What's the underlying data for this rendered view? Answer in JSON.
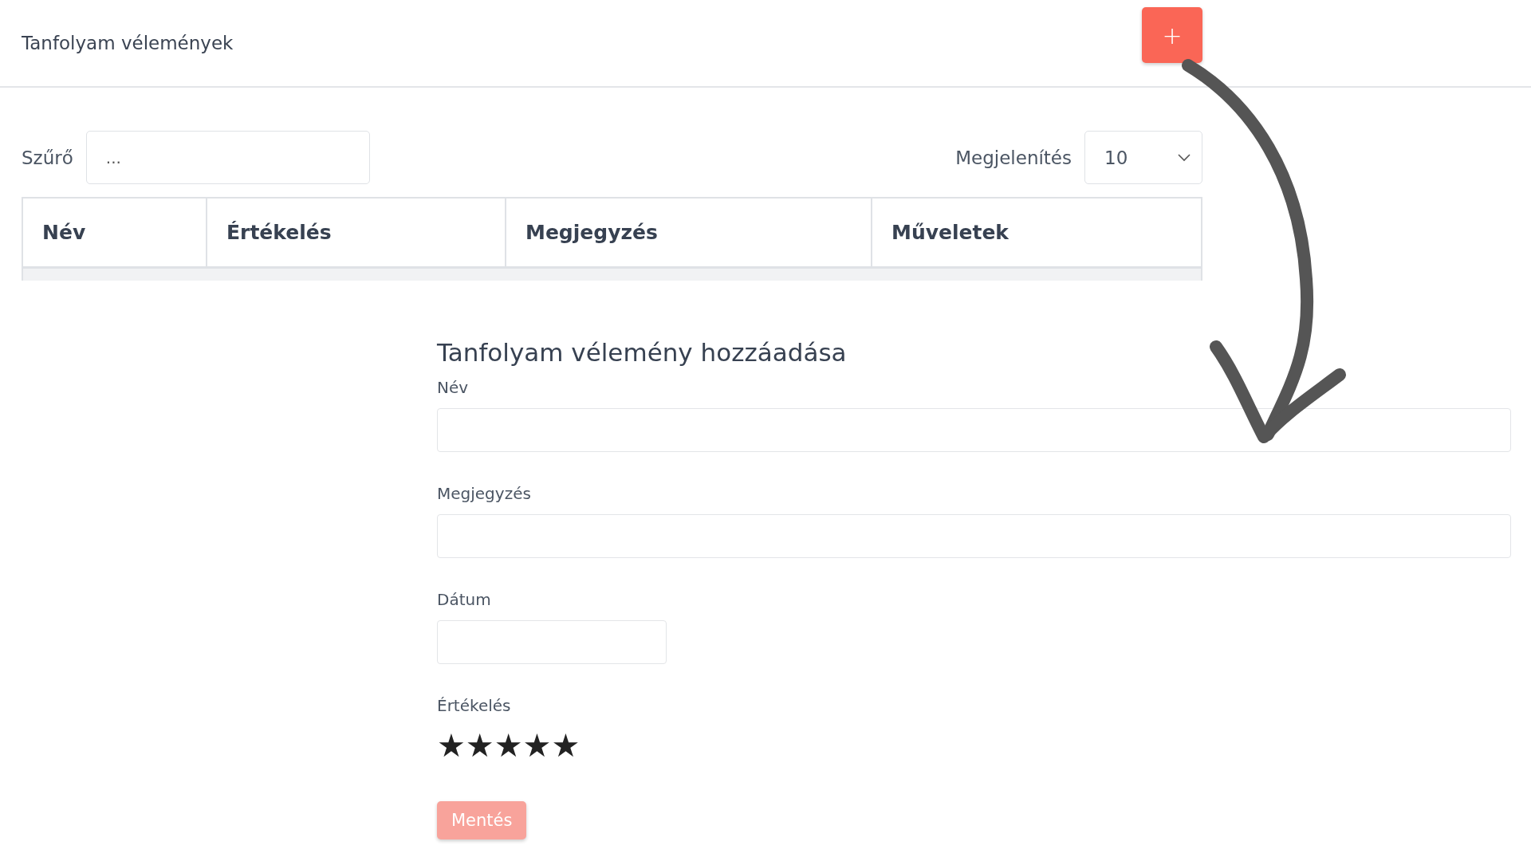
{
  "header": {
    "title": "Tanfolyam vélemények",
    "add_button": "+"
  },
  "filter": {
    "label": "Szűrő",
    "placeholder": "..."
  },
  "page_size": {
    "label": "Megjelenítés",
    "value": "10"
  },
  "table": {
    "columns": [
      "Név",
      "Értékelés",
      "Megjegyzés",
      "Műveletek"
    ]
  },
  "form": {
    "title": "Tanfolyam vélemény hozzáadása",
    "fields": [
      {
        "label": "Név",
        "kind": "wide"
      },
      {
        "label": "Megjegyzés",
        "kind": "wide"
      },
      {
        "label": "Dátum",
        "kind": "short"
      }
    ],
    "rating": {
      "label": "Értékelés",
      "stars": 5
    },
    "submit": {
      "label": "Mentés",
      "disabled": true
    }
  }
}
